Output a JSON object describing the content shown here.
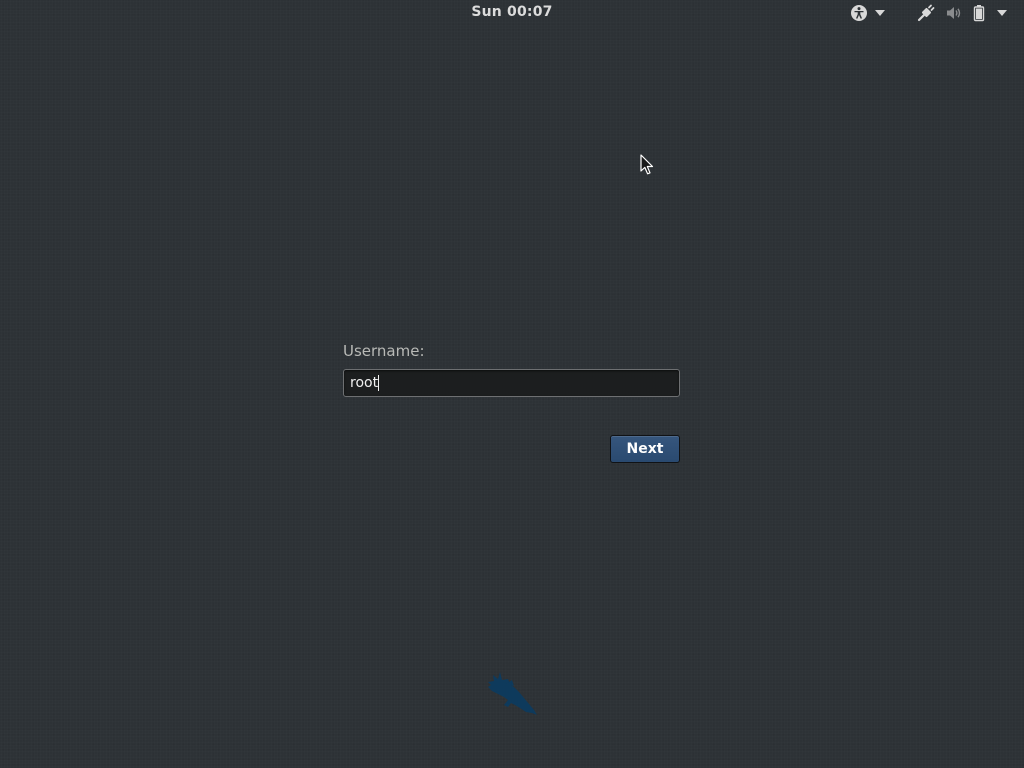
{
  "top_bar": {
    "clock": "Sun 00:07",
    "indicators": [
      {
        "icon": "accessibility-icon"
      },
      {
        "icon": "chevron-down-icon"
      },
      {
        "icon": "network-wired-icon"
      },
      {
        "icon": "volume-icon"
      },
      {
        "icon": "battery-icon"
      },
      {
        "icon": "chevron-down-icon"
      }
    ]
  },
  "login": {
    "prompt_label": "Username:",
    "username_value": "root",
    "next_label": "Next"
  },
  "logo": {
    "icon": "kali-dragon-logo-icon",
    "color": "#0e3a5c"
  },
  "colors": {
    "background": "#2d3236",
    "button_accent": "#2f5079",
    "entry_background": "#1c1e1f"
  }
}
